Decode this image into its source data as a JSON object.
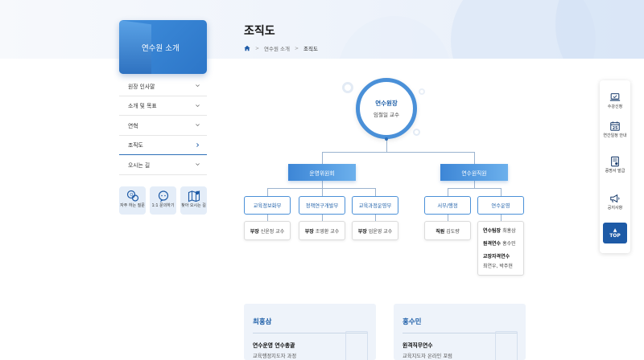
{
  "page": {
    "title": "조직도",
    "breadcrumb": [
      "연수원 소개",
      "조직도"
    ]
  },
  "sidebar": {
    "title": "연수원 소개",
    "items": [
      {
        "label": "원장 인사말"
      },
      {
        "label": "소개 및 목표"
      },
      {
        "label": "연혁"
      },
      {
        "label": "조직도"
      },
      {
        "label": "오시는 길"
      }
    ],
    "active_index": 3,
    "quick": [
      {
        "label": "자주 하는 질문",
        "icon": "faq-icon"
      },
      {
        "label": "1:1 문의하기",
        "icon": "chat-icon"
      },
      {
        "label": "찾아 오시는 길",
        "icon": "map-icon"
      }
    ]
  },
  "org": {
    "head": {
      "title": "연수원장",
      "name": "임철일 교수"
    },
    "depts": [
      {
        "label": "운영위원회"
      },
      {
        "label": "연수원직원"
      }
    ],
    "subs": [
      {
        "label": "교육정보화부"
      },
      {
        "label": "정책연구개발부"
      },
      {
        "label": "교육과정운영부"
      },
      {
        "label": "서무/행정"
      },
      {
        "label": "연수운영"
      }
    ],
    "cards": [
      {
        "role": "부장",
        "name": "신윤정 교수"
      },
      {
        "role": "부장",
        "name": "조영환 교수"
      },
      {
        "role": "부장",
        "name": "업윤영 교수"
      },
      {
        "role": "직원",
        "name": "김도량"
      }
    ],
    "ops": [
      {
        "role": "연수팀장",
        "name": "최홍삼"
      },
      {
        "role": "원격연수",
        "name": "홍수민"
      },
      {
        "role": "교장자격연수",
        "name": "최연우, 박주현"
      }
    ]
  },
  "people": [
    {
      "name": "최홍삼",
      "position": "연수운영 연수총괄",
      "desc": "교육행정지도자 과정"
    },
    {
      "name": "홍수민",
      "position": "원격직무연수",
      "desc": "교육지도자 온라인 포럼"
    }
  ],
  "float": {
    "items": [
      {
        "label": "수강신청",
        "icon": "laptop-icon"
      },
      {
        "label": "연간일정 안내",
        "icon": "calendar-icon"
      },
      {
        "label": "증명서 발급",
        "icon": "certificate-icon"
      },
      {
        "label": "공지사항",
        "icon": "megaphone-icon"
      }
    ],
    "calendar_day": "25",
    "top": "TOP"
  },
  "colors": {
    "primary": "#2d6fb8",
    "accent": "#4a90d8",
    "dark": "#1d5aa6"
  }
}
